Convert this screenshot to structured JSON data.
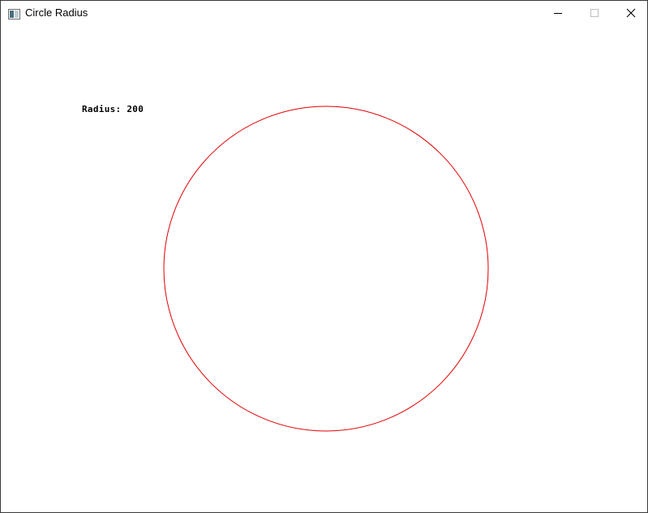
{
  "window": {
    "title": "Circle Radius"
  },
  "caption_buttons": {
    "minimize": "minimize-icon",
    "maximize": "maximize-icon",
    "close": "close-icon"
  },
  "canvas": {
    "radius_text": "Radius: 200",
    "circle": {
      "radius": 200,
      "stroke_color": "#e00000"
    }
  }
}
